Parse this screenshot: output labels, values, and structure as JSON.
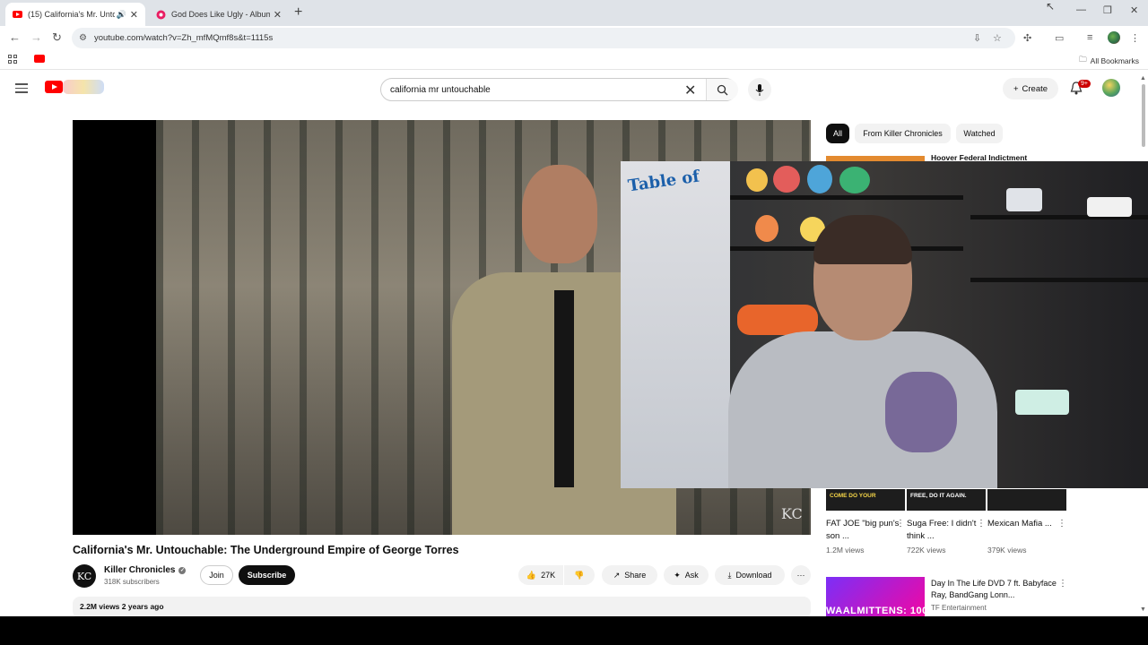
{
  "browser": {
    "tabs": [
      {
        "title": "(15) California's Mr. Untouc",
        "active": true
      },
      {
        "title": "God Does Like Ugly - Album by",
        "active": false
      }
    ],
    "url": "youtube.com/watch?v=Zh_mfMQmf8s&t=1115s",
    "bookmarks_label": "All Bookmarks"
  },
  "header": {
    "search_value": "california mr untouchable",
    "create_label": "Create",
    "notif_count": "9+"
  },
  "video": {
    "title": "California's Mr. Untouchable: The Underground Empire of George Torres",
    "channel": "Killer Chronicles",
    "channel_initials": "KC",
    "subscribers": "318K subscribers",
    "join_label": "Join",
    "subscribe_label": "Subscribe",
    "likes": "27K",
    "share_label": "Share",
    "ask_label": "Ask",
    "download_label": "Download",
    "more_label": "···",
    "stats": "2.2M views  2 years ago"
  },
  "sidebar": {
    "chips": [
      "All",
      "From Killer Chronicles",
      "Watched"
    ],
    "partial_title": "Hoover Federal Indictment",
    "reels": [
      {
        "thumb_text": "COME DO YOUR",
        "title": "FAT JOE \"big pun's  son ...",
        "views": "1.2M views"
      },
      {
        "thumb_text": "FREE, DO IT AGAIN.",
        "title": "Suga Free: I didn't think ...",
        "views": "722K views"
      },
      {
        "thumb_text": "",
        "title": "Mexican Mafia ...",
        "views": "379K views"
      }
    ],
    "rec": {
      "thumb_text": "WAALMITTENS: 100",
      "title": "Day In The Life DVD 7 ft. Babyface Ray, BandGang Lonn...",
      "channel": "TF Entertainment"
    }
  },
  "overlay": {
    "poster_text": "Table of"
  },
  "colors": {
    "brand_red": "#ff0000",
    "accent_dark": "#0f0f0f"
  }
}
